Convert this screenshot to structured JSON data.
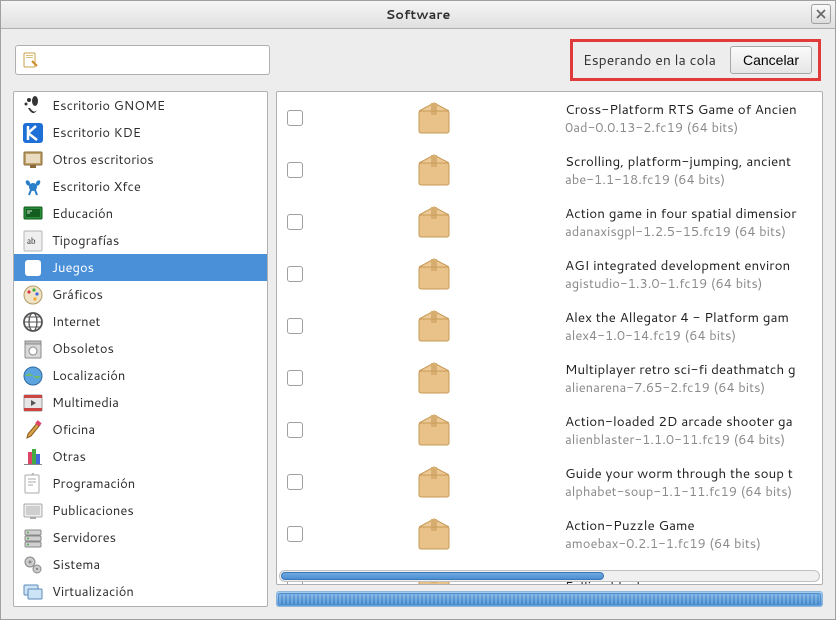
{
  "window": {
    "title": "Software"
  },
  "toolbar": {
    "status": "Esperando en la cola",
    "cancel": "Cancelar"
  },
  "sidebar": {
    "items": [
      {
        "label": "Escritorio GNOME",
        "icon": "gnome"
      },
      {
        "label": "Escritorio KDE",
        "icon": "kde"
      },
      {
        "label": "Otros escritorios",
        "icon": "desktop"
      },
      {
        "label": "Escritorio Xfce",
        "icon": "xfce"
      },
      {
        "label": "Educación",
        "icon": "education"
      },
      {
        "label": "Tipografías",
        "icon": "fonts"
      },
      {
        "label": "Juegos",
        "icon": "games",
        "selected": true
      },
      {
        "label": "Gráficos",
        "icon": "graphics"
      },
      {
        "label": "Internet",
        "icon": "internet"
      },
      {
        "label": "Obsoletos",
        "icon": "obsolete"
      },
      {
        "label": "Localización",
        "icon": "locale"
      },
      {
        "label": "Multimedia",
        "icon": "multimedia"
      },
      {
        "label": "Oficina",
        "icon": "office"
      },
      {
        "label": "Otras",
        "icon": "other"
      },
      {
        "label": "Programación",
        "icon": "dev"
      },
      {
        "label": "Publicaciones",
        "icon": "pub"
      },
      {
        "label": "Servidores",
        "icon": "servers"
      },
      {
        "label": "Sistema",
        "icon": "system"
      },
      {
        "label": "Virtualización",
        "icon": "virt"
      }
    ]
  },
  "packages": [
    {
      "title": "Cross-Platform RTS Game of Ancien",
      "sub": "0ad-0.0.13-2.fc19 (64 bits)"
    },
    {
      "title": "Scrolling, platform-jumping, ancient",
      "sub": "abe-1.1-18.fc19 (64 bits)"
    },
    {
      "title": "Action game in four spatial dimensior",
      "sub": "adanaxisgpl-1.2.5-15.fc19 (64 bits)"
    },
    {
      "title": "AGI integrated development environ",
      "sub": "agistudio-1.3.0-1.fc19 (64 bits)"
    },
    {
      "title": "Alex the Allegator 4 - Platform gam",
      "sub": "alex4-1.0-14.fc19 (64 bits)"
    },
    {
      "title": "Multiplayer retro sci-fi deathmatch g",
      "sub": "alienarena-7.65-2.fc19 (64 bits)"
    },
    {
      "title": "Action-loaded 2D arcade shooter ga",
      "sub": "alienblaster-1.1.0-11.fc19 (64 bits)"
    },
    {
      "title": "Guide your worm through the soup t",
      "sub": "alphabet-soup-1.1-11.fc19 (64 bits)"
    },
    {
      "title": "Action-Puzzle Game",
      "sub": "amoebax-0.2.1-1.fc19 (64 bits)"
    },
    {
      "title": "Falling blocks game",
      "sub": ""
    }
  ]
}
